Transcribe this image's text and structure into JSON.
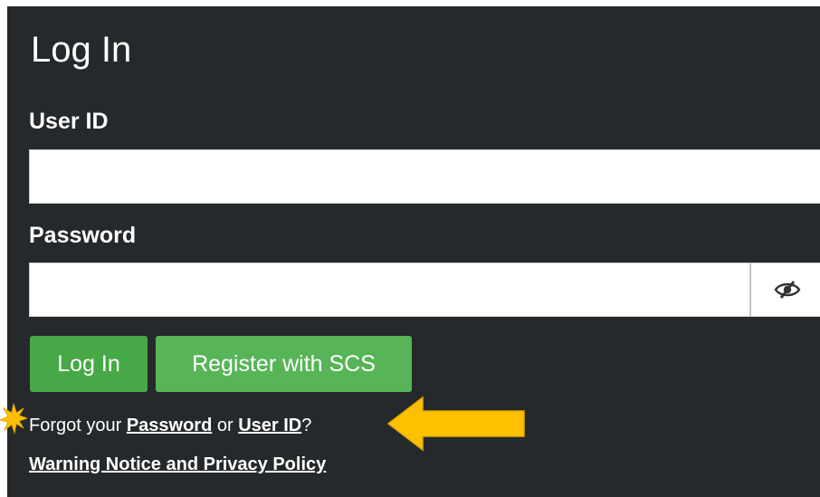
{
  "login": {
    "title": "Log In",
    "userid_label": "User ID",
    "userid_value": "",
    "password_label": "Password",
    "password_value": "",
    "password_toggle_icon": "eye-slash-icon",
    "login_button": "Log In",
    "register_button": "Register with SCS",
    "forgot_prefix": "Forgot your ",
    "forgot_password_link": "Password",
    "forgot_or": " or ",
    "forgot_userid_link": "User ID",
    "forgot_suffix": "?",
    "warning_link": "Warning Notice and Privacy Policy"
  },
  "annotations": {
    "arrow_icon": "left-arrow-icon",
    "star_icon": "star-burst-icon",
    "highlight_color": "#ffc000"
  },
  "colors": {
    "panel_background": "#26292b",
    "login_button": "#46a846",
    "register_button": "#57b557",
    "text": "#ffffff"
  }
}
